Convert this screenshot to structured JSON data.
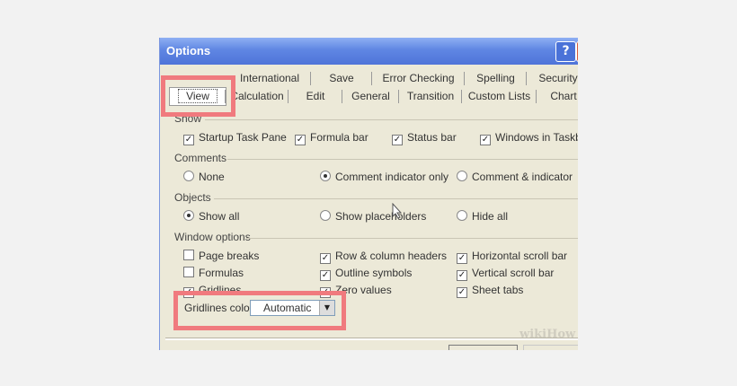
{
  "window": {
    "title": "Options",
    "help_label": "?"
  },
  "tabs_row1": [
    {
      "label": "International"
    },
    {
      "label": "Save"
    },
    {
      "label": "Error Checking"
    },
    {
      "label": "Spelling"
    },
    {
      "label": "Security"
    }
  ],
  "tabs_row2": [
    {
      "label": "View",
      "active": true
    },
    {
      "label": "Calculation"
    },
    {
      "label": "Edit"
    },
    {
      "label": "General"
    },
    {
      "label": "Transition"
    },
    {
      "label": "Custom Lists"
    },
    {
      "label": "Chart"
    }
  ],
  "show": {
    "heading": "Show",
    "items": [
      {
        "label": "Startup Task Pane",
        "checked": true
      },
      {
        "label": "Formula bar",
        "checked": true
      },
      {
        "label": "Status bar",
        "checked": true
      },
      {
        "label": "Windows in Taskbar",
        "checked": true
      }
    ]
  },
  "comments": {
    "heading": "Comments",
    "items": [
      {
        "label": "None",
        "selected": false
      },
      {
        "label": "Comment indicator only",
        "selected": true
      },
      {
        "label": "Comment & indicator",
        "selected": false
      }
    ]
  },
  "objects": {
    "heading": "Objects",
    "items": [
      {
        "label": "Show all",
        "selected": true
      },
      {
        "label": "Show placeholders",
        "selected": false
      },
      {
        "label": "Hide all",
        "selected": false
      }
    ]
  },
  "window_options": {
    "heading": "Window options",
    "items": [
      {
        "label": "Page breaks",
        "checked": false
      },
      {
        "label": "Row & column headers",
        "checked": true
      },
      {
        "label": "Horizontal scroll bar",
        "checked": true
      },
      {
        "label": "Formulas",
        "checked": false
      },
      {
        "label": "Outline symbols",
        "checked": true
      },
      {
        "label": "Vertical scroll bar",
        "checked": true
      },
      {
        "label": "Gridlines",
        "checked": true
      },
      {
        "label": "Zero values",
        "checked": true
      },
      {
        "label": "Sheet tabs",
        "checked": true
      }
    ]
  },
  "gridlines_color": {
    "label": "Gridlines color:",
    "value": "Automatic"
  },
  "watermark": "wikiHow",
  "colors": {
    "titlebar": "#5f86e3",
    "dialog_bg": "#ece9d8",
    "highlight": "#f07a7e"
  }
}
